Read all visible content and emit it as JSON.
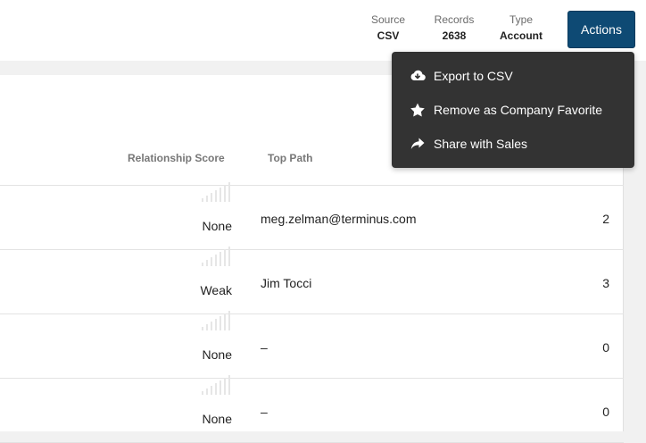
{
  "header": {
    "source": {
      "label": "Source",
      "value": "CSV"
    },
    "records": {
      "label": "Records",
      "value": "2638"
    },
    "type": {
      "label": "Type",
      "value": "Account"
    },
    "actions_label": "Actions"
  },
  "actions_menu": {
    "items": [
      {
        "label": "Export to CSV",
        "icon": "cloud-download-icon"
      },
      {
        "label": "Remove as Company Favorite",
        "icon": "star-icon"
      },
      {
        "label": "Share with Sales",
        "icon": "share-icon"
      }
    ]
  },
  "table": {
    "columns": {
      "score": "Relationship Score",
      "path": "Top Path"
    },
    "rows": [
      {
        "score": "None",
        "path": "meg.zelman@terminus.com",
        "count": "2"
      },
      {
        "score": "Weak",
        "path": "Jim Tocci",
        "count": "3"
      },
      {
        "score": "None",
        "path": "–",
        "count": "0"
      },
      {
        "score": "None",
        "path": "–",
        "count": "0"
      }
    ]
  },
  "colors": {
    "accent": "#0e4a74",
    "menu_bg": "#333333"
  }
}
